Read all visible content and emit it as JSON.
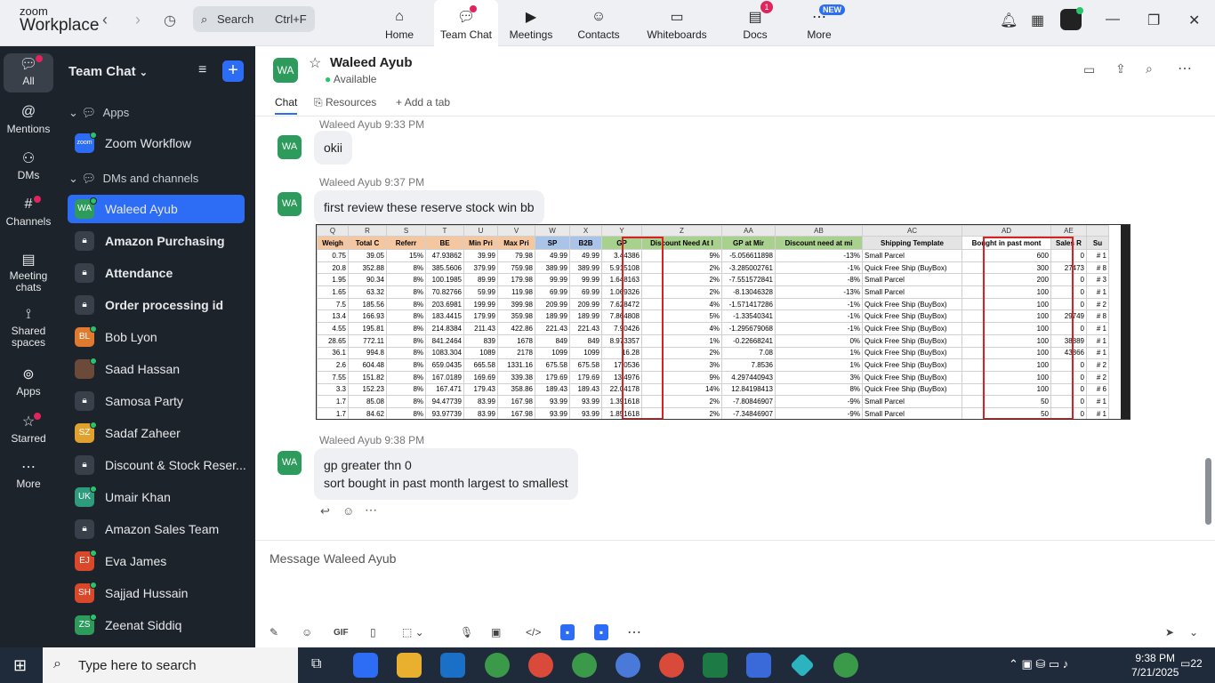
{
  "app": {
    "logo_line1": "zoom",
    "logo_line2": "Workplace"
  },
  "search": {
    "label": "Search",
    "shortcut": "Ctrl+F"
  },
  "tabs": [
    {
      "label": "Home",
      "icon": "home-icon"
    },
    {
      "label": "Team Chat",
      "icon": "chat-icon",
      "active": true
    },
    {
      "label": "Meetings",
      "icon": "video-icon"
    },
    {
      "label": "Contacts",
      "icon": "contacts-icon"
    },
    {
      "label": "Whiteboards",
      "icon": "whiteboard-icon"
    },
    {
      "label": "Docs",
      "icon": "docs-icon",
      "badge": "1"
    },
    {
      "label": "More",
      "icon": "more-icon",
      "badge": "NEW"
    }
  ],
  "rail": [
    {
      "label": "All",
      "icon": "chat-bubble-icon"
    },
    {
      "label": "Mentions",
      "icon": "at-icon"
    },
    {
      "label": "DMs",
      "icon": "people-icon"
    },
    {
      "label": "Channels",
      "icon": "hash-icon"
    },
    {
      "label": "Meeting chats",
      "icon": "calendar-icon"
    },
    {
      "label": "Shared spaces",
      "icon": "shared-icon"
    },
    {
      "label": "Apps",
      "icon": "apps-icon"
    },
    {
      "label": "Starred",
      "icon": "star-icon"
    },
    {
      "label": "More",
      "icon": "ellipsis-icon"
    }
  ],
  "sidebar": {
    "title": "Team Chat",
    "sections": {
      "apps": "Apps",
      "dms": "DMs and channels"
    },
    "items": [
      {
        "name": "Zoom Workflow",
        "avatar": "zoom",
        "color": "#2d6df6"
      },
      {
        "name": "Waleed Ayub",
        "avatar": "WA",
        "color": "#2d9b5c",
        "selected": true
      },
      {
        "name": "Amazon Purchasing",
        "lock": true,
        "bold": true
      },
      {
        "name": "Attendance",
        "lock": true,
        "bold": true
      },
      {
        "name": "Order processing id",
        "lock": true,
        "bold": true
      },
      {
        "name": "Bob Lyon",
        "avatar": "BL",
        "color": "#e07a2e"
      },
      {
        "name": "Saad Hassan",
        "avatar": "",
        "color": "#6b4a3a"
      },
      {
        "name": "Samosa Party",
        "lock": true
      },
      {
        "name": "Sadaf Zaheer",
        "avatar": "SZ",
        "color": "#e0a12e"
      },
      {
        "name": "Discount & Stock Reser...",
        "lock": true
      },
      {
        "name": "Umair Khan",
        "avatar": "UK",
        "color": "#2d9b7c"
      },
      {
        "name": "Amazon Sales Team",
        "lock": true
      },
      {
        "name": "Eva James",
        "avatar": "EJ",
        "color": "#d9482b"
      },
      {
        "name": "Sajjad Hussain",
        "avatar": "SH",
        "color": "#d9482b"
      },
      {
        "name": "Zeenat Siddiq",
        "avatar": "ZS",
        "color": "#2d9b5c"
      }
    ]
  },
  "chat": {
    "avatar": "WA",
    "name": "Waleed Ayub",
    "status": "Available",
    "tabs": [
      "Chat",
      "Resources",
      "Add a tab"
    ],
    "messages": [
      {
        "meta": "Waleed Ayub 9:33 PM",
        "text": "okii"
      },
      {
        "meta": "Waleed Ayub 9:37 PM",
        "text": "first review these reserve stock win bb"
      },
      {
        "meta": "Waleed Ayub 9:38 PM",
        "text1": "gp greater thn 0",
        "text2": "sort bought in past month largest to smallest"
      }
    ],
    "compose_placeholder": "Message Waleed Ayub"
  },
  "sheet": {
    "letters": [
      "Q",
      "R",
      "S",
      "T",
      "U",
      "V",
      "W",
      "X",
      "Y",
      "Z",
      "AA",
      "AB",
      "AC",
      "AD",
      "AE",
      ""
    ],
    "headers": [
      "Weigh",
      "Total C",
      "Referr",
      "BE",
      "Min Pri",
      "Max Pri",
      "SP",
      "B2B",
      "GP",
      "Discount Need At I",
      "GP at Mir",
      "Discount need at mi",
      "Shipping Template",
      "Bought in past mont",
      "Sales R",
      "Su"
    ],
    "rows": [
      [
        "0.75",
        "39.05",
        "15%",
        "47.93862",
        "39.99",
        "79.98",
        "49.99",
        "49.99",
        "3.44386",
        "9%",
        "-5.056611898",
        "-13%",
        "Small Parcel",
        "600",
        "0",
        "# 1"
      ],
      [
        "20.8",
        "352.88",
        "8%",
        "385.5606",
        "379.99",
        "759.98",
        "389.99",
        "389.99",
        "5.915108",
        "2%",
        "-3.285002761",
        "-1%",
        "Quick Free Ship (BuyBox)",
        "300",
        "27473",
        "# 8"
      ],
      [
        "1.95",
        "90.34",
        "8%",
        "100.1985",
        "89.99",
        "179.98",
        "99.99",
        "99.99",
        "1.648163",
        "2%",
        "-7.551572841",
        "-8%",
        "Small Parcel",
        "200",
        "0",
        "# 3"
      ],
      [
        "1.65",
        "63.32",
        "8%",
        "70.82766",
        "59.99",
        "119.98",
        "69.99",
        "69.99",
        "1.069326",
        "2%",
        "-8.13046328",
        "-13%",
        "Small Parcel",
        "100",
        "0",
        "# 1"
      ],
      [
        "7.5",
        "185.56",
        "8%",
        "203.6981",
        "199.99",
        "399.98",
        "209.99",
        "209.99",
        "7.628472",
        "4%",
        "-1.571417286",
        "-1%",
        "Quick Free Ship (BuyBox)",
        "100",
        "0",
        "# 2"
      ],
      [
        "13.4",
        "166.93",
        "8%",
        "183.4415",
        "179.99",
        "359.98",
        "189.99",
        "189.99",
        "7.864808",
        "5%",
        "-1.33540341",
        "-1%",
        "Quick Free Ship (BuyBox)",
        "100",
        "29749",
        "# 8"
      ],
      [
        "4.55",
        "195.81",
        "8%",
        "214.8384",
        "211.43",
        "422.86",
        "221.43",
        "221.43",
        "7.90426",
        "4%",
        "-1.295679068",
        "-1%",
        "Quick Free Ship (BuyBox)",
        "100",
        "0",
        "# 1"
      ],
      [
        "28.65",
        "772.11",
        "8%",
        "841.2464",
        "839",
        "1678",
        "849",
        "849",
        "8.973357",
        "1%",
        "-0.22668241",
        "0%",
        "Quick Free Ship (BuyBox)",
        "100",
        "38889",
        "# 1"
      ],
      [
        "36.1",
        "994.8",
        "8%",
        "1083.304",
        "1089",
        "2178",
        "1099",
        "1099",
        "16.28",
        "2%",
        "7.08",
        "1%",
        "Quick Free Ship (BuyBox)",
        "100",
        "43866",
        "# 1"
      ],
      [
        "2.6",
        "604.48",
        "8%",
        "659.0435",
        "665.58",
        "1331.16",
        "675.58",
        "675.58",
        "17.0536",
        "3%",
        "7.8536",
        "1%",
        "Quick Free Ship (BuyBox)",
        "100",
        "0",
        "# 2"
      ],
      [
        "7.55",
        "151.82",
        "8%",
        "167.0189",
        "169.69",
        "339.38",
        "179.69",
        "179.69",
        "13.4976",
        "9%",
        "4.297440943",
        "3%",
        "Quick Free Ship (BuyBox)",
        "100",
        "0",
        "# 2"
      ],
      [
        "3.3",
        "152.23",
        "8%",
        "167.471",
        "179.43",
        "358.86",
        "189.43",
        "189.43",
        "22.04178",
        "14%",
        "12.84198413",
        "8%",
        "Quick Free Ship (BuyBox)",
        "100",
        "0",
        "# 6"
      ],
      [
        "1.7",
        "85.08",
        "8%",
        "94.47739",
        "83.99",
        "167.98",
        "93.99",
        "93.99",
        "1.391618",
        "2%",
        "-7.80846907",
        "-9%",
        "Small Parcel",
        "50",
        "0",
        "# 1"
      ],
      [
        "1.7",
        "84.62",
        "8%",
        "93.97739",
        "83.99",
        "167.98",
        "93.99",
        "93.99",
        "1.851618",
        "2%",
        "-7.34846907",
        "-9%",
        "Small Parcel",
        "50",
        "0",
        "# 1"
      ]
    ]
  },
  "taskbar": {
    "search": "Type here to search",
    "time": "9:38 PM",
    "date": "7/21/2025",
    "notif": "22"
  }
}
